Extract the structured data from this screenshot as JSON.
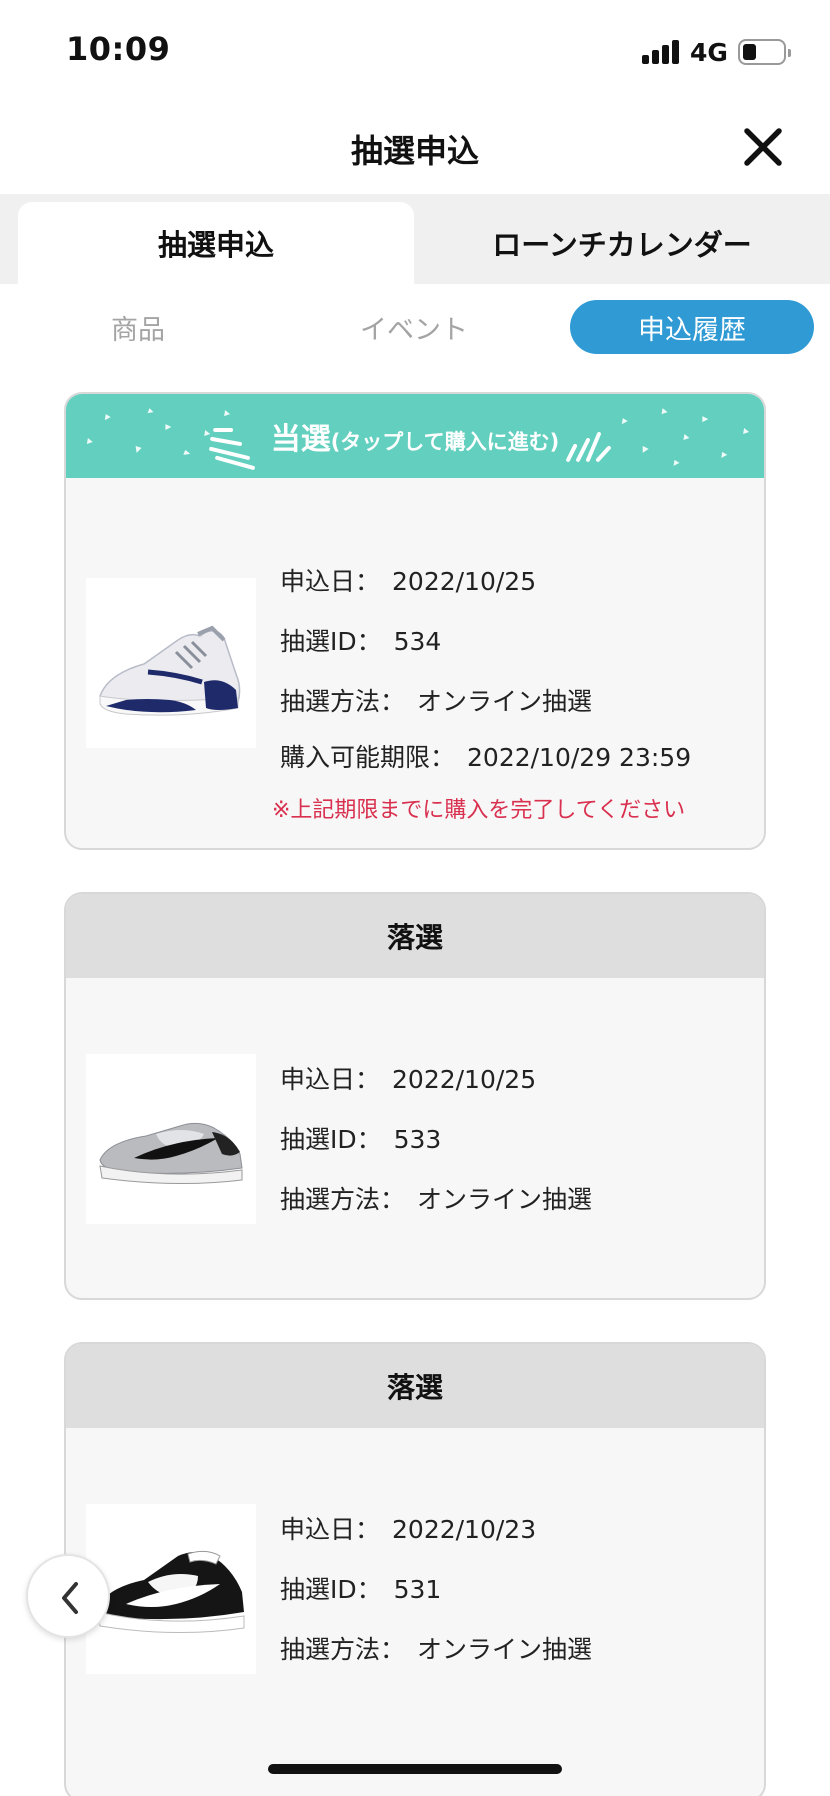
{
  "status": {
    "time": "10:09",
    "network": "4G",
    "battery_level": 0.35
  },
  "header": {
    "title": "抽選申込"
  },
  "segments": [
    {
      "label": "抽選申込",
      "active": true
    },
    {
      "label": "ローンチカレンダー",
      "active": false
    }
  ],
  "subtabs": [
    {
      "label": "商品",
      "active": false
    },
    {
      "label": "イベント",
      "active": false
    },
    {
      "label": "申込履歴",
      "active": true
    }
  ],
  "colors": {
    "accent": "#2f9ad4",
    "win_banner": "#62cfbf",
    "lose_banner": "#dedede",
    "warning": "#d9304f"
  },
  "labels": {
    "applied_date": "申込日：",
    "lottery_id": "抽選ID：",
    "method": "抽選方法：",
    "deadline": "購入可能期限："
  },
  "entries": [
    {
      "status": "win",
      "banner_main": "当選",
      "banner_sub": "(タップして購入に進む)",
      "applied_date": "2022/10/25",
      "lottery_id": "534",
      "method": "オンライン抽選",
      "deadline": "2022/10/29 23:59",
      "warning": "※上記期限までに購入を完了してください",
      "image_icon": "sneaker-white-navy-icon"
    },
    {
      "status": "lose",
      "banner": "落選",
      "applied_date": "2022/10/25",
      "lottery_id": "533",
      "method": "オンライン抽選",
      "image_icon": "sneaker-grey-black-icon"
    },
    {
      "status": "lose",
      "banner": "落選",
      "applied_date": "2022/10/23",
      "lottery_id": "531",
      "method": "オンライン抽選",
      "image_icon": "sneaker-black-white-icon"
    }
  ]
}
